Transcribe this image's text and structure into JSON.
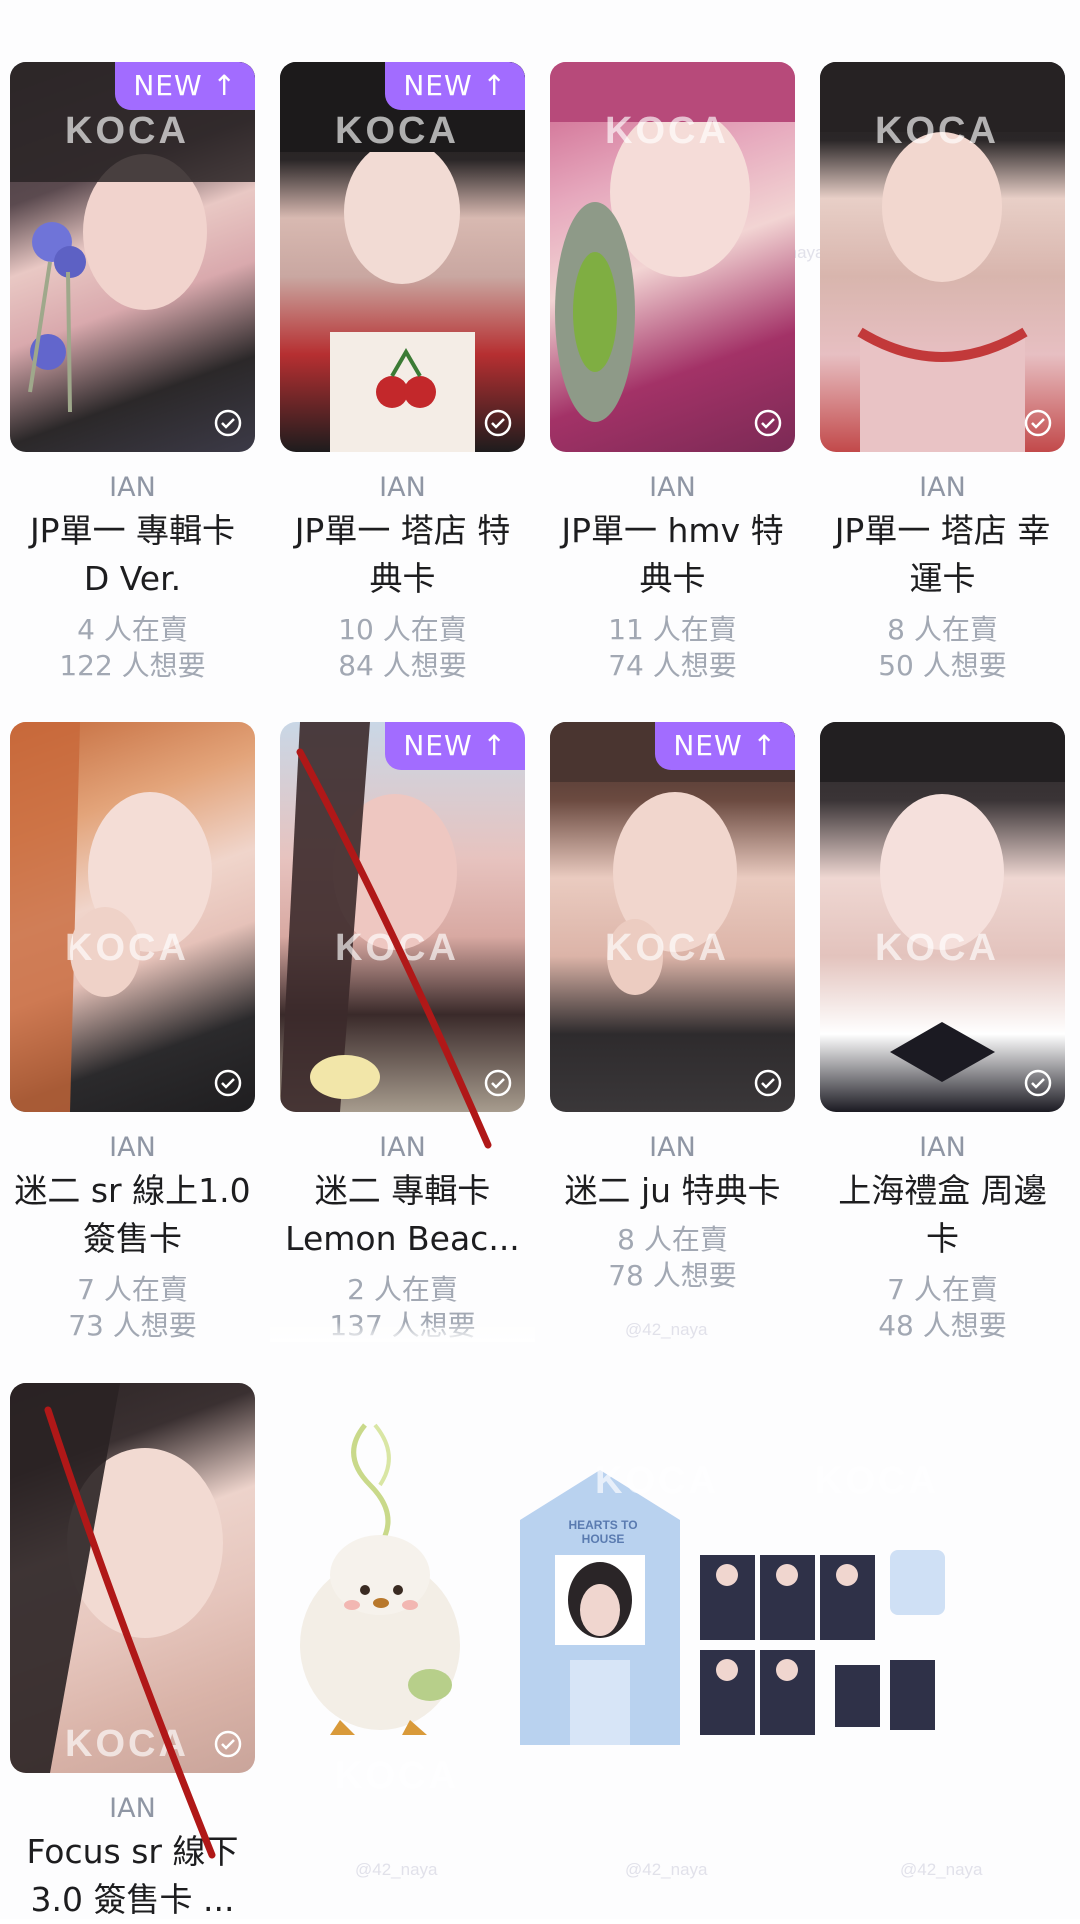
{
  "watermark": {
    "logo": "KOCA",
    "handle": "@42_naya"
  },
  "badge_new": "NEW ↑",
  "colors": {
    "badge": "#a26cff",
    "artist": "#8f96a4",
    "stats": "#a2a8b3",
    "annotation": "#b01818"
  },
  "cards": [
    {
      "artist": "IAN",
      "name_line1": "JP單一 專輯卡",
      "name_line2": "D Ver.",
      "sellers": "4 人在賣",
      "wants": "122 人想要",
      "is_new": true
    },
    {
      "artist": "IAN",
      "name_line1": "JP單一 塔店 特",
      "name_line2": "典卡",
      "sellers": "10 人在賣",
      "wants": "84 人想要",
      "is_new": true
    },
    {
      "artist": "IAN",
      "name_line1": "JP單一 hmv 特",
      "name_line2": "典卡",
      "sellers": "11 人在賣",
      "wants": "74 人想要",
      "is_new": false
    },
    {
      "artist": "IAN",
      "name_line1": "JP單一 塔店 幸",
      "name_line2": "運卡",
      "sellers": "8 人在賣",
      "wants": "50 人想要",
      "is_new": false
    },
    {
      "artist": "IAN",
      "name_line1": "迷二 sr 線上1.0",
      "name_line2": "簽售卡",
      "sellers": "7 人在賣",
      "wants": "73 人想要",
      "is_new": false
    },
    {
      "artist": "IAN",
      "name_line1": "迷二 專輯卡",
      "name_line2": "Lemon Beac...",
      "sellers": "2 人在賣",
      "wants": "137 人想要",
      "is_new": true
    },
    {
      "artist": "IAN",
      "name_line1": "迷二 ju 特典卡",
      "name_line2": "",
      "sellers": "8 人在賣",
      "wants": "78 人想要",
      "is_new": true
    },
    {
      "artist": "IAN",
      "name_line1": "上海禮盒 周邊",
      "name_line2": "卡",
      "sellers": "7 人在賣",
      "wants": "48 人想要",
      "is_new": false
    },
    {
      "artist": "IAN",
      "name_line1": "Focus sr 線下",
      "name_line2": "3.0 簽售卡 ...",
      "sellers": "",
      "wants": "",
      "is_new": false
    }
  ],
  "merch": {
    "house_sign": "HEARTS TO HOUSE"
  }
}
